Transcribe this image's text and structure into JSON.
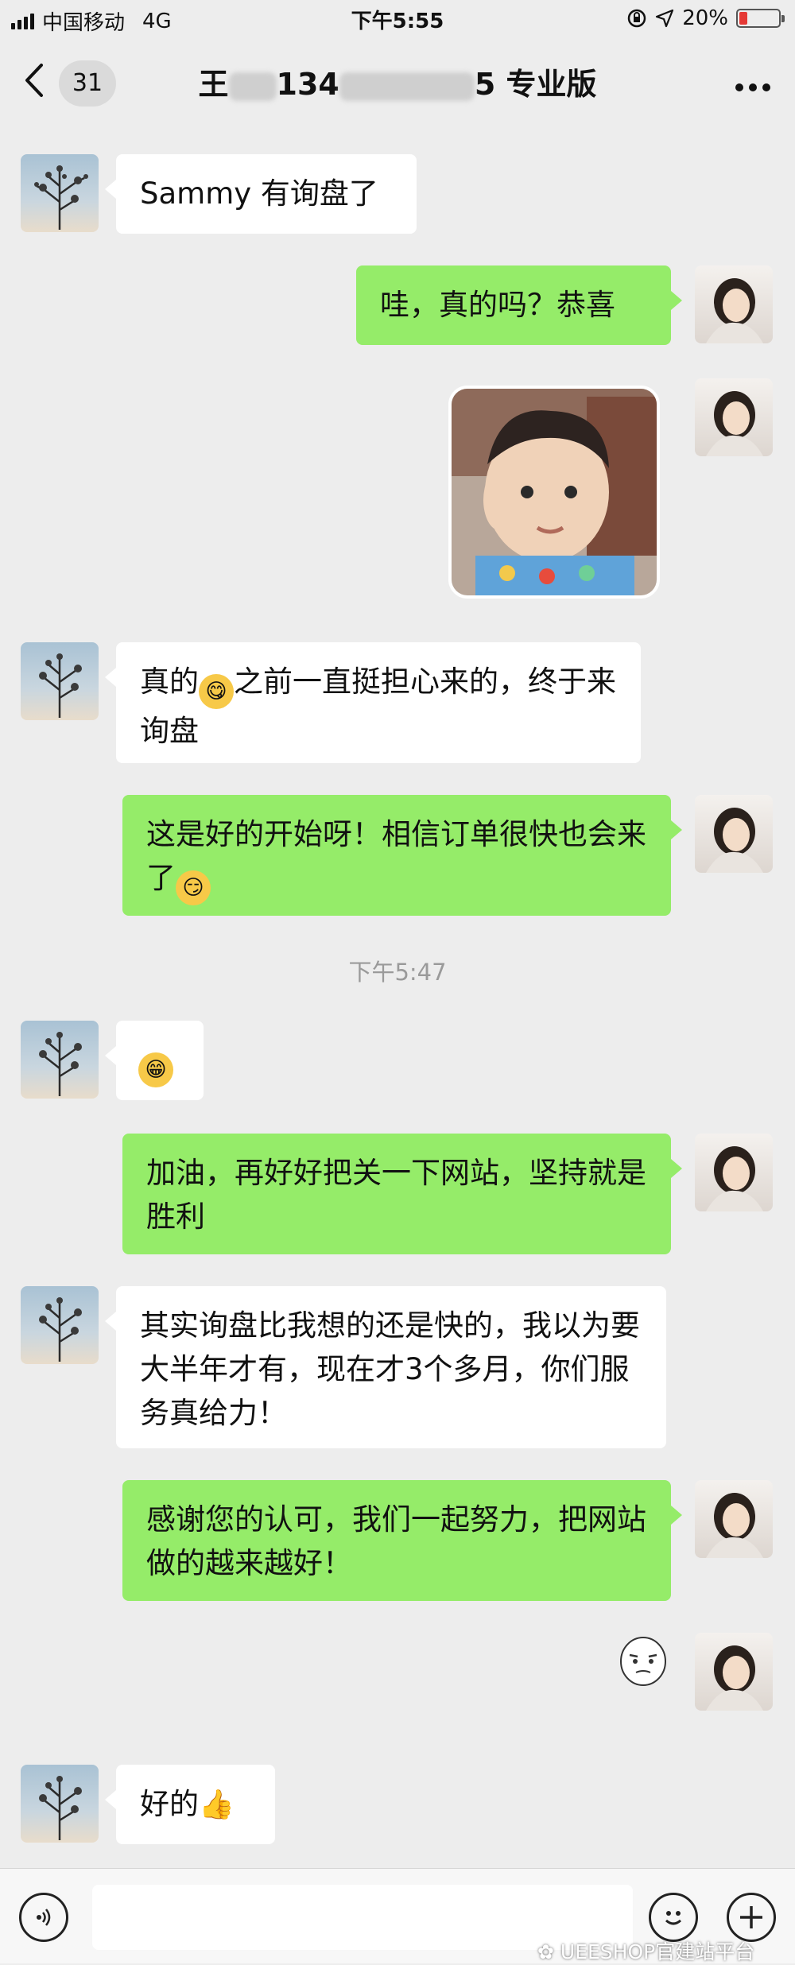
{
  "status_bar": {
    "carrier": "中国移动",
    "network": "4G",
    "time": "下午5:55",
    "battery_percent": "20%",
    "battery_level": 0.2
  },
  "nav": {
    "back_icon": "chevron-left-icon",
    "unread_count": "31",
    "title_prefix": "王",
    "title_mid": "134",
    "title_suffix": "5 专业版",
    "more_icon": "more-dots-icon"
  },
  "messages": {
    "m1": "Sammy 有询盘了",
    "m2": "哇，真的吗？恭喜",
    "m4a": "真的",
    "m4b": "之前一直挺担心来的，终于来询盘",
    "m5": "这是好的开始呀！相信订单很快也会来了",
    "timestamp": "下午5:47",
    "m7": "加油，再好好把关一下网站，坚持就是胜利",
    "m8": "其实询盘比我想的还是快的，我以为要大半年才有，现在才3个多月，你们服务真给力！",
    "m9": "感谢您的认可，我们一起努力，把网站做的越来越好！",
    "m11": "好的"
  },
  "icons": {
    "emoji_1": "tongue-out-emoji",
    "emoji_2": "smirk-emoji",
    "emoji_3": "grin-emoji",
    "emoji_4": "thumbs-up-emoji",
    "sticker": "meme-face-sticker",
    "voice": "voice-icon",
    "face": "emoji-face-icon",
    "plus": "plus-icon"
  },
  "colors": {
    "outgoing_bubble": "#95ec69",
    "incoming_bubble": "#ffffff",
    "background": "#ededed"
  },
  "watermark": "UEESHOP官建站平台"
}
